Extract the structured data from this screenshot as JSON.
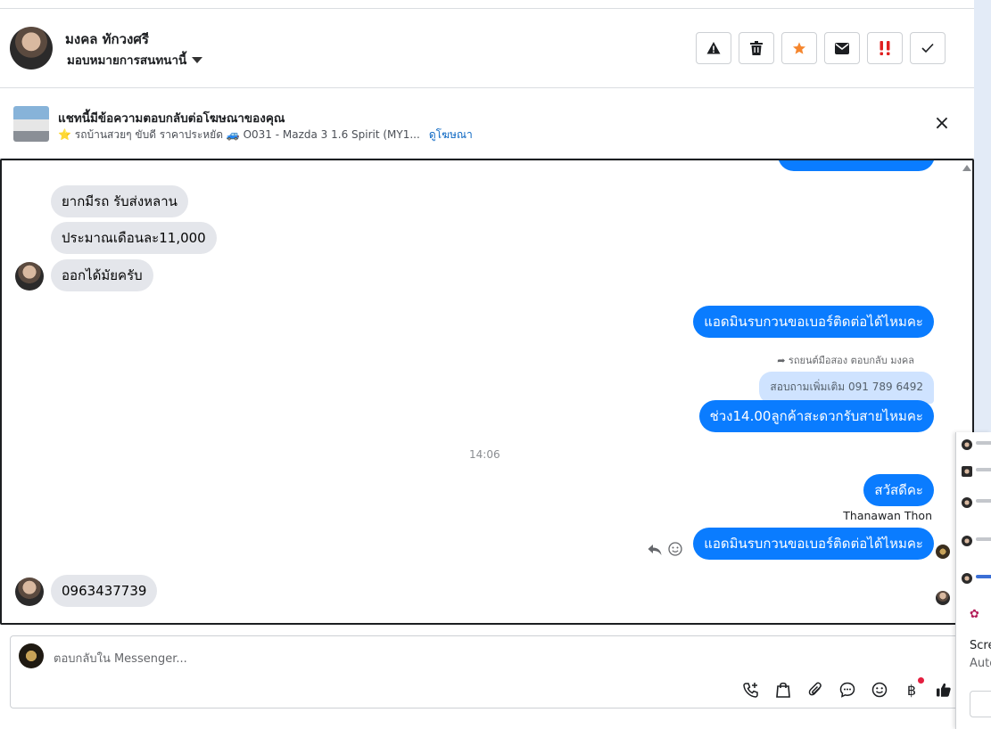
{
  "header": {
    "name": "มงคล ทักวงศรี",
    "assign_label": "มอบหมายการสนทนานี้",
    "actions": [
      {
        "icon": "warning-icon"
      },
      {
        "icon": "trash-icon"
      },
      {
        "icon": "star-icon",
        "color": "#f5862e"
      },
      {
        "icon": "envelope-icon"
      },
      {
        "icon": "exclamation-icon",
        "color": "#e02020"
      },
      {
        "icon": "check-icon"
      }
    ]
  },
  "ad": {
    "title": "แชทนี้มีข้อความตอบกลับต่อโฆษณาของคุณ",
    "description": "⭐ รถบ้านสวยๆ ขับดี ราคาประหยัด 🚙 O031 - Mazda 3 1.6 Spirit (MY1...",
    "link": "ดูโฆษณา",
    "close": "×"
  },
  "messages": {
    "in1": "ยากมีรถ รับส่งหลาน",
    "in2": "ประมาณเดือนละ11,000",
    "in3": "ออกได้มัยครับ",
    "out1": "แอดมินรบกวนขอเบอร์ติดต่อได้ไหมคะ",
    "reply_meta": "➦ รถยนต์มือสอง ตอบกลับ มงคล",
    "quoted": "สอบถามเพิ่มเติม 091 789 6492",
    "out2": "ช่วง14.00ลูกค้าสะดวกรับสายไหมคะ",
    "timestamp": "14:06",
    "out3": "สวัสดีคะ",
    "sender": "Thanawan Thon",
    "out4": "แอดมินรบกวนขอเบอร์ติดต่อได้ไหมคะ",
    "in4": "0963437739"
  },
  "composer": {
    "placeholder": "ตอบกลับใน Messenger..."
  },
  "colors": {
    "outgoing_bubble": "#0a7cff",
    "incoming_bubble": "#e4e6eb",
    "link": "#0a66c2"
  },
  "side_panel": {
    "text1": "Scre",
    "text2": "Auto"
  }
}
